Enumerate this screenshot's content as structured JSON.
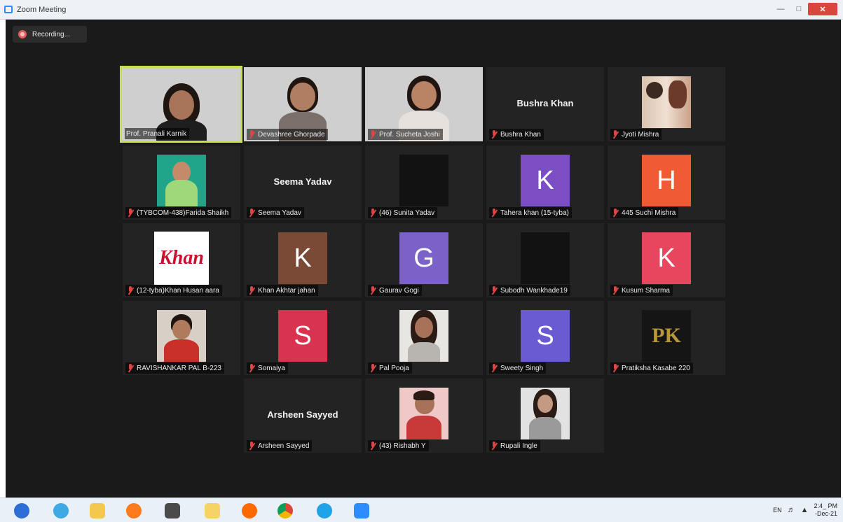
{
  "window": {
    "title": "Zoom Meeting"
  },
  "recording": {
    "label": "Recording..."
  },
  "participants": [
    {
      "name": "Prof. Pranali Karnik"
    },
    {
      "name": "Devashree Ghorpade"
    },
    {
      "name": "Prof. Sucheta Joshi"
    },
    {
      "name": "Bushra Khan",
      "display": "Bushra Khan"
    },
    {
      "name": "Jyoti Mishra"
    },
    {
      "name": "(TYBCOM-438)Farida Shaikh"
    },
    {
      "name": "Seema Yadav",
      "display": "Seema Yadav"
    },
    {
      "name": "(46) Sunita Yadav"
    },
    {
      "name": "Tahera khan (15-tyba)",
      "initial": "K",
      "color": "#7b4fc3"
    },
    {
      "name": "445 Suchi Mishra",
      "initial": "H",
      "color": "#f05a34"
    },
    {
      "name": "(12-tyba)Khan Husan aara",
      "logo": "Khan"
    },
    {
      "name": "Khan Akhtar jahan",
      "initial": "K",
      "color": "#7a4a36"
    },
    {
      "name": "Gaurav Gogi",
      "initial": "G",
      "color": "#7a62c9"
    },
    {
      "name": "Subodh Wankhade19"
    },
    {
      "name": "Kusum Sharma",
      "initial": "K",
      "color": "#e8455e"
    },
    {
      "name": "RAVISHANKAR PAL B-223"
    },
    {
      "name": "Somaiya",
      "initial": "S",
      "color": "#d8344f"
    },
    {
      "name": "Pal Pooja"
    },
    {
      "name": "Sweety Singh",
      "initial": "S",
      "color": "#6a5bd2"
    },
    {
      "name": "Pratiksha Kasabe 220",
      "logo": "PK"
    },
    {
      "name": "Arsheen Sayyed",
      "display": "Arsheen Sayyed"
    },
    {
      "name": "(43) Rishabh Y"
    },
    {
      "name": "Rupali Ingle"
    }
  ],
  "taskbar": {
    "lang": "EN",
    "time": "2:4_ PM",
    "date": "-Dec-21"
  },
  "colors": {
    "active_border": "#c9e04c",
    "mic_muted": "#e04545",
    "stage_bg": "#1a1a1a"
  }
}
